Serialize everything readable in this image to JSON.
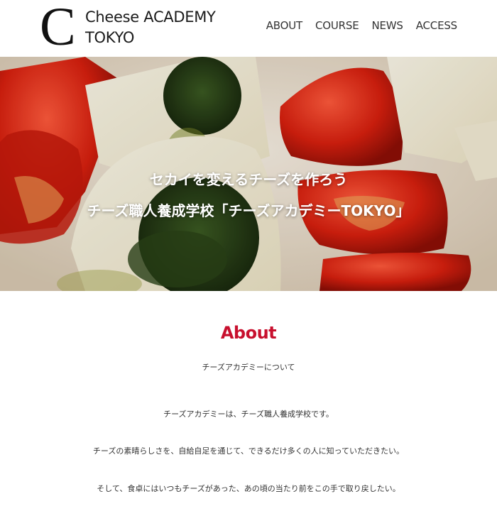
{
  "header": {
    "logo_mark": "C",
    "logo_line1": "Cheese ACADEMY",
    "logo_line2": "TOKYO",
    "nav": [
      "ABOUT",
      "COURSE",
      "NEWS",
      "ACCESS"
    ]
  },
  "hero": {
    "line1": "セカイを変えるチーズを作ろう",
    "line2": "チーズ職人養成学校「チーズアカデミーTOKYO」"
  },
  "about": {
    "title": "About",
    "subtitle": "チーズアカデミーについて",
    "paragraphs": [
      "チーズアカデミーは、チーズ職人養成学校です。",
      "チーズの素晴らしさを、自給自足を通じて、できるだけ多くの人に知っていただきたい。",
      "そして、食卓にはいつもチーズがあった、あの頃の当たり前をこの手で取り戻したい。"
    ]
  },
  "colors": {
    "accent": "#c8102e",
    "text": "#333333",
    "hero_overlay_text": "#ffffff"
  }
}
